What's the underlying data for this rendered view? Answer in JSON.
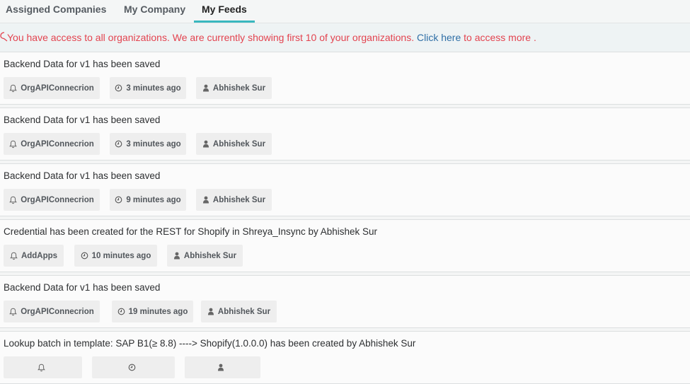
{
  "tabs": [
    {
      "label": "Assigned Companies",
      "active": false
    },
    {
      "label": "My Company",
      "active": false
    },
    {
      "label": "My Feeds",
      "active": true
    }
  ],
  "notice": {
    "text_before": "You have access to all organizations. We are currently showing first 10 of your organizations. ",
    "link": "Click here",
    "text_after": " to access more ."
  },
  "feeds": [
    {
      "title": "Backend Data for v1 has been saved",
      "source": "OrgAPIConnecrion",
      "time": "3 minutes ago",
      "user": "Abhishek Sur"
    },
    {
      "title": "Backend Data for v1 has been saved",
      "source": "OrgAPIConnecrion",
      "time": "3 minutes ago",
      "user": "Abhishek Sur"
    },
    {
      "title": "Backend Data for v1 has been saved",
      "source": "OrgAPIConnecrion",
      "time": "9 minutes ago",
      "user": "Abhishek Sur"
    },
    {
      "title": "Credential has been created for the REST for Shopify in Shreya_Insync by Abhishek Sur",
      "source": "AddApps",
      "time": "10 minutes ago",
      "user": "Abhishek Sur"
    },
    {
      "title": "Backend Data for v1 has been saved",
      "source": "OrgAPIConnecrion",
      "time": "19 minutes ago",
      "user": "Abhishek Sur"
    },
    {
      "title": "Lookup batch in template: SAP B1(≥ 8.8) ----> Shopify(1.0.0.0) has been created by Abhishek Sur",
      "source": "",
      "time": "",
      "user": ""
    }
  ],
  "icons": {
    "source": "bell-icon",
    "time": "clock-icon",
    "user": "user-icon",
    "notice": "alert-icon"
  },
  "colors": {
    "accent": "#38b7bf",
    "notice_text": "#e3434f",
    "link": "#2f6fa6"
  }
}
